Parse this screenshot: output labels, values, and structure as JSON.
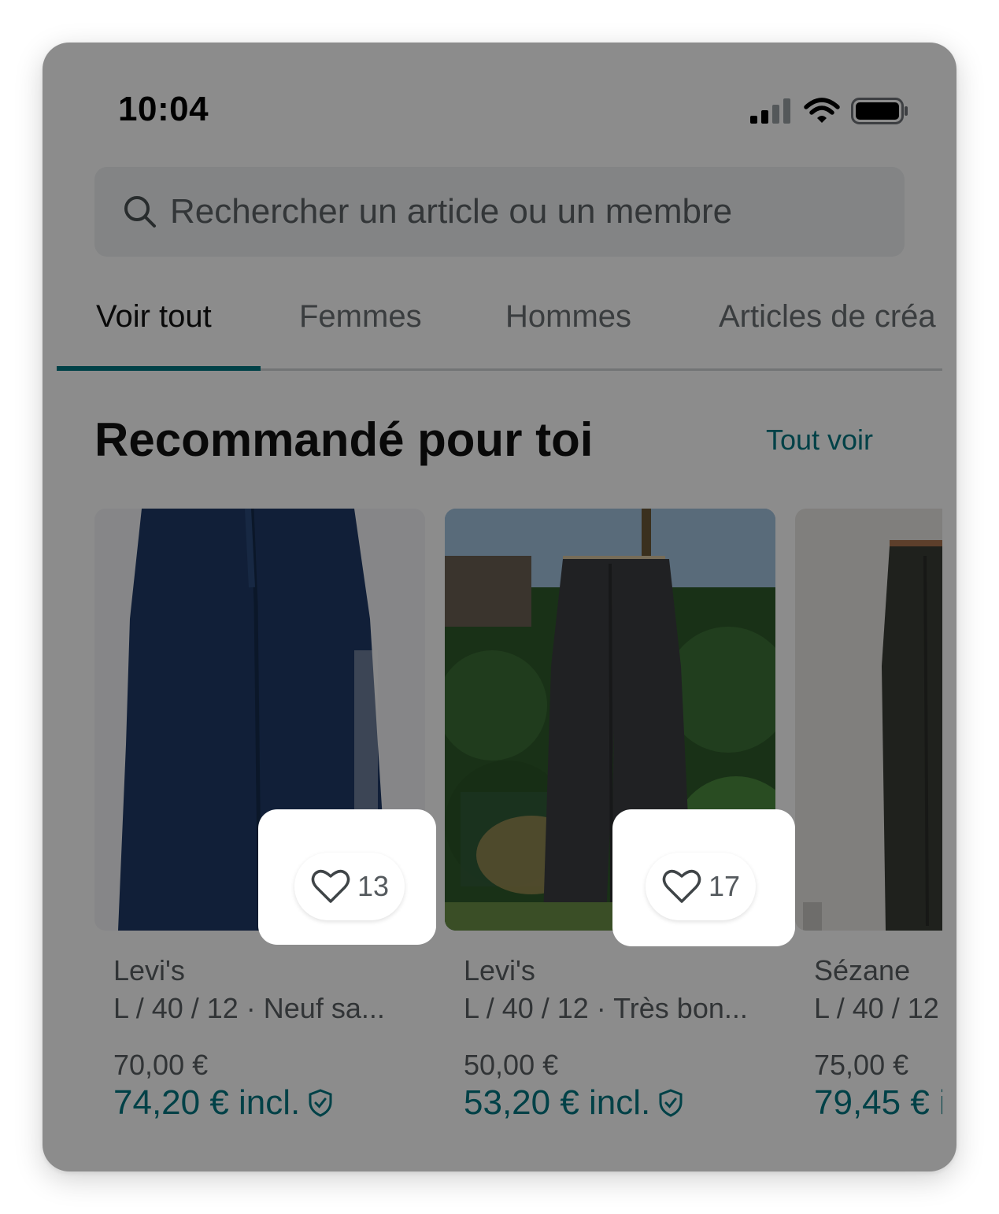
{
  "status_bar": {
    "time": "10:04",
    "icons": [
      "signal-icon",
      "wifi-icon",
      "battery-icon"
    ]
  },
  "search": {
    "placeholder": "Rechercher un article ou un membre",
    "icon": "search-icon"
  },
  "tabs": [
    {
      "label": "Voir tout",
      "active": true
    },
    {
      "label": "Femmes",
      "active": false
    },
    {
      "label": "Hommes",
      "active": false
    },
    {
      "label": "Articles de créa",
      "active": false
    }
  ],
  "section": {
    "title": "Recommandé pour toi",
    "see_all": "Tout voir"
  },
  "products": [
    {
      "brand": "Levi's",
      "details": "L / 40 / 12 · Neuf sa...",
      "price": "70,00 €",
      "price_incl": "74,20 € incl.",
      "likes": "13",
      "image": "dark-blue-jeans-photo"
    },
    {
      "brand": "Levi's",
      "details": "L / 40 / 12 · Très bon...",
      "price": "50,00 €",
      "price_incl": "53,20 € incl.",
      "likes": "17",
      "image": "grey-jeans-garden-photo"
    },
    {
      "brand": "Sézane",
      "details": "L / 40 / 12",
      "price": "75,00 €",
      "price_incl": "79,45 € i",
      "image": "grey-trousers-photo"
    }
  ],
  "colors": {
    "accent": "#007782",
    "overlay": "rgba(0,0,0,0.45)",
    "highlight": "#ffffff"
  }
}
